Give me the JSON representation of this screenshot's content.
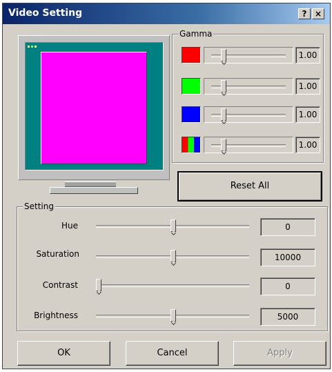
{
  "window": {
    "title": "Video Setting",
    "help_glyph": "?",
    "close_glyph": "×"
  },
  "gamma": {
    "group_label": "Gamma",
    "rows": [
      {
        "swatch": "red",
        "value": "1.00"
      },
      {
        "swatch": "green",
        "value": "1.00"
      },
      {
        "swatch": "blue",
        "value": "1.00"
      },
      {
        "swatch": "rgb",
        "value": "1.00"
      }
    ]
  },
  "reset_label": "Reset All",
  "setting": {
    "group_label": "Setting",
    "rows": [
      {
        "label": "Hue",
        "value": "0"
      },
      {
        "label": "Saturation",
        "value": "10000"
      },
      {
        "label": "Contrast",
        "value": "0"
      },
      {
        "label": "Brightness",
        "value": "5000"
      }
    ]
  },
  "buttons": {
    "ok": "OK",
    "cancel": "Cancel",
    "apply": "Apply"
  },
  "colors": {
    "preview_screen": "#008080",
    "preview_window": "#ff00ff",
    "title_bar": "#0a246a"
  }
}
